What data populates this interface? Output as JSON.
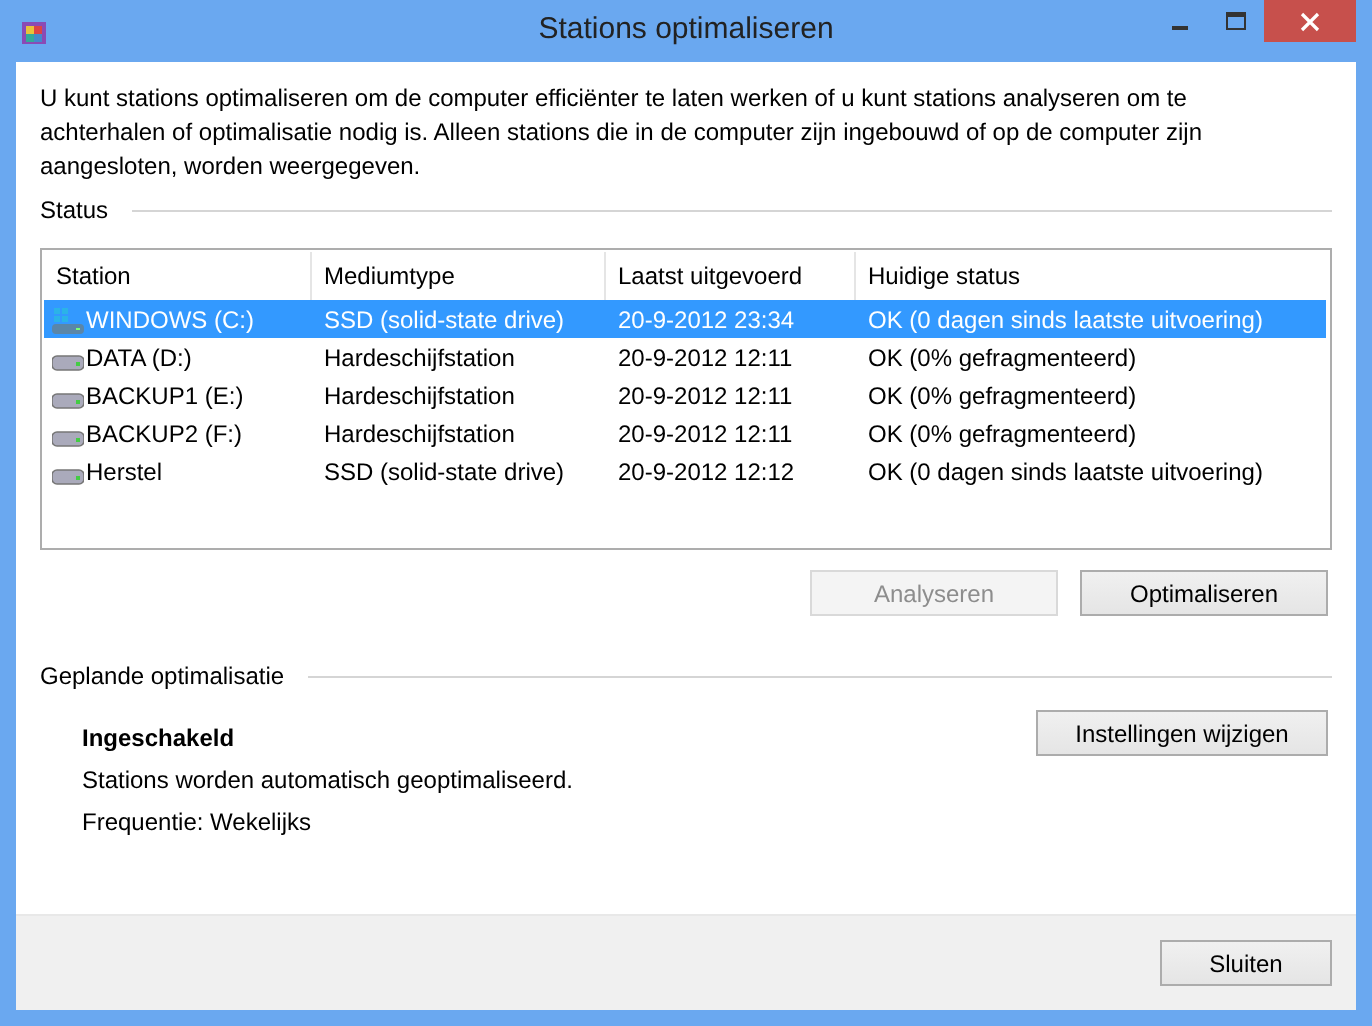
{
  "window": {
    "title": "Stations optimaliseren"
  },
  "intro": "U kunt stations optimaliseren om de computer efficiënter te laten werken of u kunt stations analyseren om te achterhalen of optimalisatie nodig is. Alleen stations die in de computer zijn ingebouwd of op de computer zijn aangesloten, worden weergegeven.",
  "status_section": {
    "title": "Status"
  },
  "table": {
    "columns": [
      "Station",
      "Mediumtype",
      "Laatst uitgevoerd",
      "Huidige status"
    ],
    "rows": [
      {
        "kind": "system",
        "selected": true,
        "cells": [
          "WINDOWS (C:)",
          "SSD (solid-state drive)",
          "20-9-2012 23:34",
          "OK (0 dagen sinds laatste uitvoering)"
        ]
      },
      {
        "kind": "disk",
        "selected": false,
        "cells": [
          "DATA (D:)",
          "Hardeschijfstation",
          "20-9-2012 12:11",
          "OK (0% gefragmenteerd)"
        ]
      },
      {
        "kind": "disk",
        "selected": false,
        "cells": [
          "BACKUP1 (E:)",
          "Hardeschijfstation",
          "20-9-2012 12:11",
          "OK (0% gefragmenteerd)"
        ]
      },
      {
        "kind": "disk",
        "selected": false,
        "cells": [
          "BACKUP2 (F:)",
          "Hardeschijfstation",
          "20-9-2012 12:11",
          "OK (0% gefragmenteerd)"
        ]
      },
      {
        "kind": "disk",
        "selected": false,
        "cells": [
          "Herstel",
          "SSD (solid-state drive)",
          "20-9-2012 12:12",
          "OK (0 dagen sinds laatste uitvoering)"
        ]
      }
    ]
  },
  "actions": [
    {
      "label": "Analyseren",
      "disabled": true
    },
    {
      "label": "Optimaliseren",
      "disabled": false
    }
  ],
  "schedule": {
    "title": "Geplande optimalisatie",
    "state": "Ingeschakeld",
    "description": "Stations worden automatisch geoptimaliseerd.",
    "frequency": "Frequentie: Wekelijks",
    "button": "Instellingen wijzigen"
  },
  "footer": {
    "button": "Sluiten"
  }
}
